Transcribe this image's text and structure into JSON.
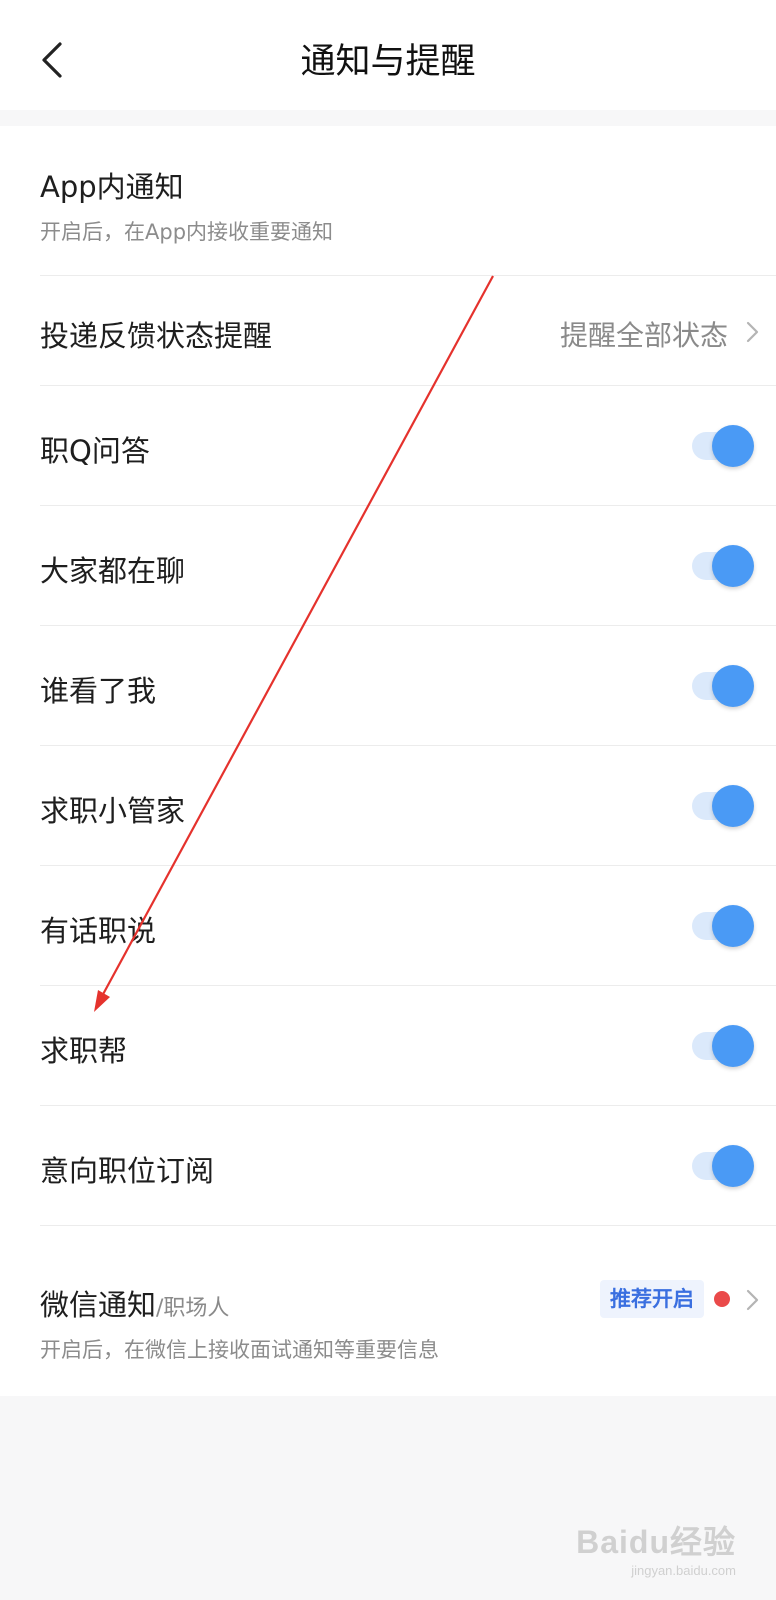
{
  "header": {
    "title": "通知与提醒"
  },
  "app_notify": {
    "title": "App内通知",
    "desc": "开启后，在App内接收重要通知"
  },
  "delivery": {
    "label": "投递反馈状态提醒",
    "value": "提醒全部状态"
  },
  "toggles": [
    {
      "label": "职Q问答",
      "on": true
    },
    {
      "label": "大家都在聊",
      "on": true
    },
    {
      "label": "谁看了我",
      "on": true
    },
    {
      "label": "求职小管家",
      "on": true
    },
    {
      "label": "有话职说",
      "on": true
    },
    {
      "label": "求职帮",
      "on": true
    },
    {
      "label": "意向职位订阅",
      "on": true
    }
  ],
  "wechat": {
    "title": "微信通知",
    "subtitle": "/职场人",
    "badge": "推荐开启",
    "desc": "开启后，在微信上接收面试通知等重要信息"
  },
  "watermark": {
    "logo": "Baidu经验",
    "url": "jingyan.baidu.com"
  },
  "colors": {
    "accent": "#4a9af5",
    "track": "#dbe9fb",
    "badge_text": "#3a6fe0",
    "badge_bg": "#eef3fd",
    "red_dot": "#ea4a4a",
    "annotation_arrow": "#e5322d"
  }
}
